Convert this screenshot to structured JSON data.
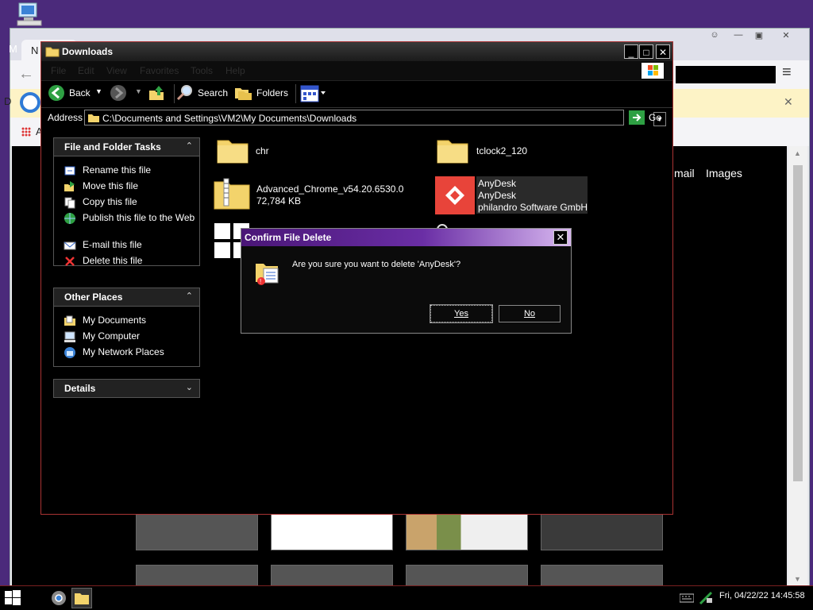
{
  "browser": {
    "tab_label": "N",
    "m_label": "M",
    "info_prefix": "D",
    "bookmarks_label": "A",
    "google_links": [
      "mail",
      "Images"
    ]
  },
  "explorer": {
    "title": "Downloads",
    "menu": [
      "File",
      "Edit",
      "View",
      "Favorites",
      "Tools",
      "Help"
    ],
    "toolbar": {
      "back": "Back",
      "search": "Search",
      "folders": "Folders"
    },
    "address": {
      "label": "Address",
      "path": "C:\\Documents and Settings\\VM2\\My Documents\\Downloads",
      "go": "Go"
    },
    "tasks_panel": {
      "title": "File and Folder Tasks",
      "items": [
        "Rename this file",
        "Move this file",
        "Copy this file",
        "Publish this file to the Web",
        "E-mail this file",
        "Delete this file"
      ]
    },
    "other_places": {
      "title": "Other Places",
      "items": [
        "My Documents",
        "My Computer",
        "My Network Places"
      ]
    },
    "details": {
      "title": "Details"
    },
    "files": [
      {
        "name": "chr"
      },
      {
        "name": "tclock2_120"
      },
      {
        "name": "Advanced_Chrome_v54.20.6530.0",
        "size": "72,784 KB"
      },
      {
        "name": "AnyDesk",
        "description": "AnyDesk",
        "company": "philandro Software GmbH"
      }
    ]
  },
  "dialog": {
    "title": "Confirm File Delete",
    "message": "Are you sure you want to delete 'AnyDesk'?",
    "yes": "Yes",
    "no": "No"
  },
  "taskbar": {
    "clock": "Fri, 04/22/22 14:45:58"
  },
  "colors": {
    "desktop": "#4b2a7b",
    "dialog_title": "#6a2ea5",
    "anydesk": "#e8443a"
  }
}
